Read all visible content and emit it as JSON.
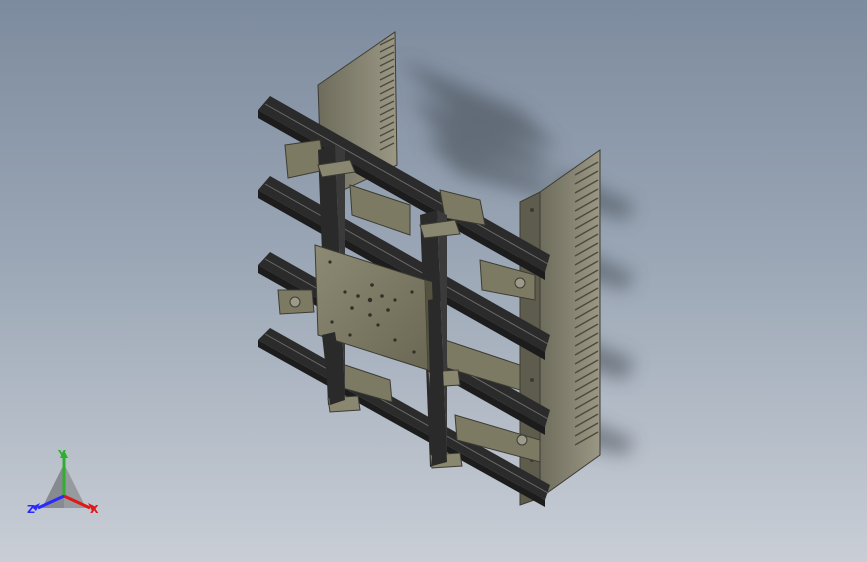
{
  "viewport": {
    "background_top": "#7d8b9e",
    "background_bottom": "#c9ced6"
  },
  "model": {
    "part_color": "#7d7a64",
    "rail_color": "#2b2b2b",
    "frame_color": "#4a4a42"
  },
  "triad": {
    "x_label": "X",
    "y_label": "Y",
    "z_label": "Z",
    "x_color": "#e01818",
    "y_color": "#2fae2f",
    "z_color": "#2a2aff"
  }
}
